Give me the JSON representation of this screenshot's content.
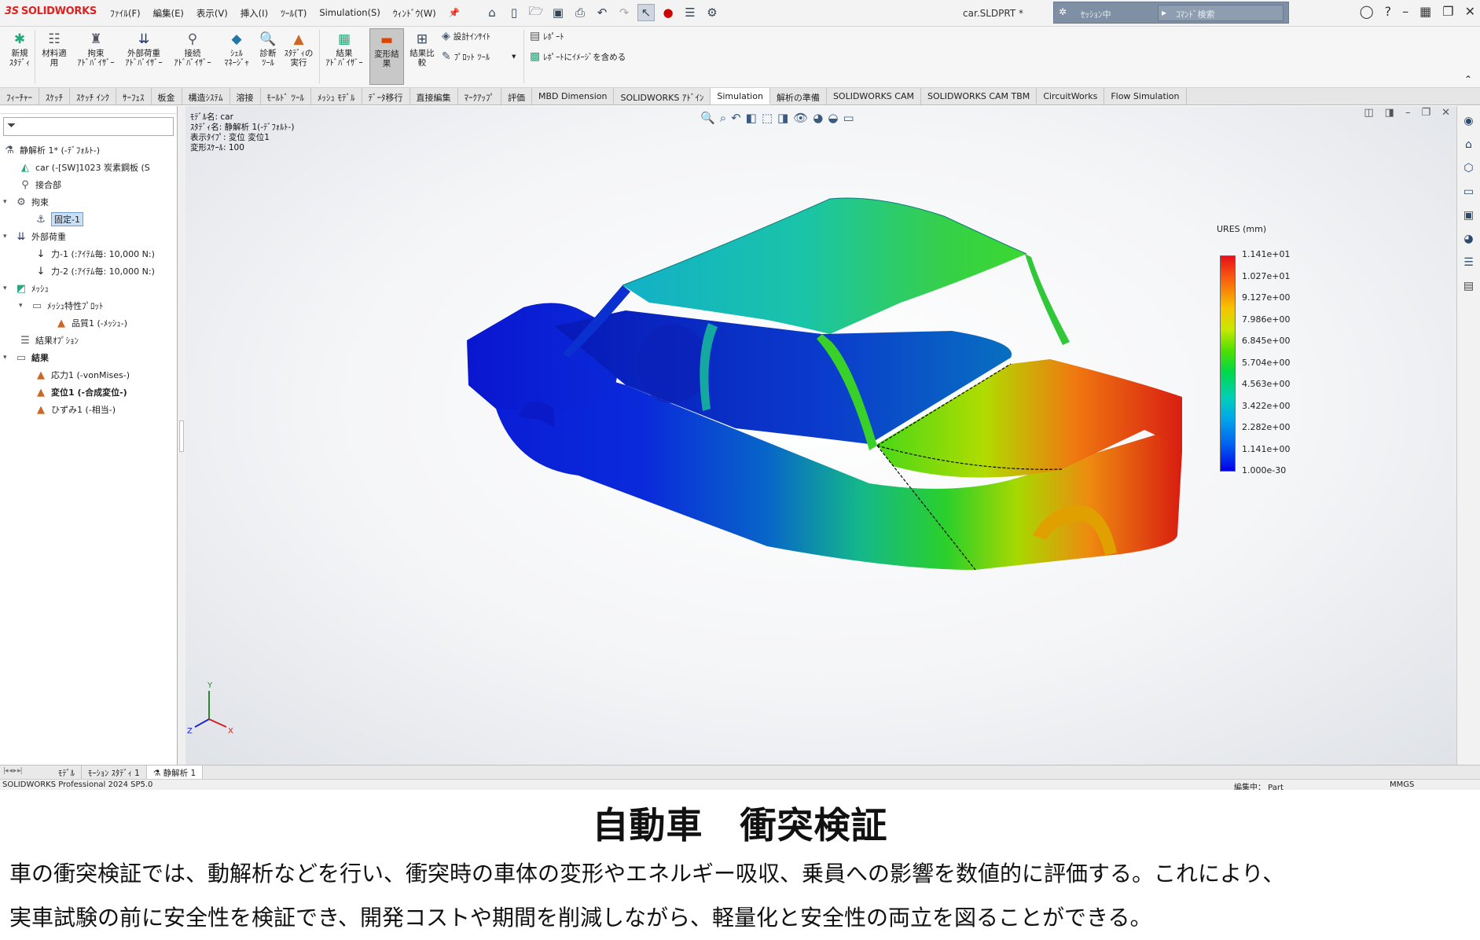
{
  "app": {
    "logo_mark": "3S",
    "logo_text": "SOLIDWORKS",
    "menus": [
      "ﾌｧｲﾙ(F)",
      "編集(E)",
      "表示(V)",
      "挿入(I)",
      "ﾂｰﾙ(T)",
      "Simulation(S)",
      "ｳｨﾝﾄﾞｳ(W)"
    ],
    "file_title": "car.SLDPRT *",
    "session_text": "ｾｯｼｮﾝ中",
    "command_search_placeholder": "ｺﾏﾝﾄﾞ検索"
  },
  "ribbon": {
    "new_study": "新規\nｽﾀﾃﾞｨ",
    "apply_material": "材料適\n用",
    "fixtures_advisor": "拘束\nｱﾄﾞﾊﾞｲｻﾞｰ",
    "external_loads_advisor": "外部荷重\nｱﾄﾞﾊﾞｲｻﾞｰ",
    "connections_advisor": "接続\nｱﾄﾞﾊﾞｲｻﾞｰ",
    "shell_manager": "ｼｪﾙ\nﾏﾈｰｼﾞｬ",
    "diagnostic_tools": "診断\nﾂｰﾙ",
    "run_study": "ｽﾀﾃﾞｨの\n実行",
    "results_advisor": "結果\nｱﾄﾞﾊﾞｲｻﾞｰ",
    "deformed_result": "変形結\n果",
    "compare_results": "結果比\n較",
    "design_insight": "設計ｲﾝｻｲﾄ",
    "plot_tools": "ﾌﾟﾛｯﾄ ﾂｰﾙ",
    "report": "ﾚﾎﾟｰﾄ",
    "include_image": "ﾚﾎﾟｰﾄにｲﾒｰｼﾞを含める"
  },
  "command_tabs": [
    "ﾌｨｰﾁｬｰ",
    "ｽｹｯﾁ",
    "ｽｹｯﾁ ｲﾝｸ",
    "ｻｰﾌｪｽ",
    "板金",
    "構造ｼｽﾃﾑ",
    "溶接",
    "ﾓｰﾙﾄﾞ ﾂｰﾙ",
    "ﾒｯｼｭ ﾓﾃﾞﾙ",
    "ﾃﾞｰﾀ移行",
    "直接編集",
    "ﾏｰｸｱｯﾌﾟ",
    "評価",
    "MBD Dimension",
    "SOLIDWORKS ｱﾄﾞｲﾝ",
    "Simulation",
    "解析の準備",
    "SOLIDWORKS CAM",
    "SOLIDWORKS CAM TBM",
    "CircuitWorks",
    "Flow Simulation"
  ],
  "active_command_tab": "Simulation",
  "tree": {
    "study": "静解析 1* (-ﾃﾞﾌｫﾙﾄ-)",
    "part": "car (-[SW]1023 炭素鋼板 (S",
    "connections": "接合部",
    "fixtures": "拘束",
    "fixed": "固定-1",
    "external_loads": "外部荷重",
    "force1": "力-1 (:ｱｲﾃﾑ毎: 10,000 N:)",
    "force2": "力-2 (:ｱｲﾃﾑ毎: 10,000 N:)",
    "mesh": "ﾒｯｼｭ",
    "mesh_plot": "ﾒｯｼｭ特性ﾌﾟﾛｯﾄ",
    "quality": "品質1 (-ﾒｯｼｭ-)",
    "result_options": "結果ｵﾌﾟｼｮﾝ",
    "results": "結果",
    "stress": "応力1 (-vonMises-)",
    "displacement": "変位1 (-合成変位-)",
    "strain": "ひずみ1 (-相当-)"
  },
  "viewport": {
    "info_lines": [
      "ﾓﾃﾞﾙ名: car",
      "ｽﾀﾃﾞｨ名: 静解析 1(-ﾃﾞﾌｫﾙﾄ-)",
      "表示ﾀｲﾌﾟ: 変位 変位1",
      "変形ｽｹｰﾙ: 100"
    ],
    "legend_title": "URES (mm)",
    "legend_values": [
      "1.141e+01",
      "1.027e+01",
      "9.127e+00",
      "7.986e+00",
      "6.845e+00",
      "5.704e+00",
      "4.563e+00",
      "3.422e+00",
      "2.282e+00",
      "1.141e+00",
      "1.000e-30"
    ],
    "axis_labels": {
      "x": "X",
      "y": "Y",
      "z": "Z"
    }
  },
  "bottom_tabs": [
    "ﾓﾃﾞﾙ",
    "ﾓｰｼｮﾝ ｽﾀﾃﾞｨ 1",
    "静解析 1"
  ],
  "status": {
    "version": "SOLIDWORKS Professional 2024 SP5.0",
    "editing": "編集中： Part",
    "units": "MMGS"
  },
  "caption": {
    "heading": "自動車　衝突検証",
    "line1": "車の衝突検証では、動解析などを行い、衝突時の車体の変形やエネルギー吸収、乗員への影響を数値的に評価する。これにより、",
    "line2": "実車試験の前に安全性を検証でき、開発コストや期間を削減しながら、軽量化と安全性の両立を図ることができる。"
  }
}
